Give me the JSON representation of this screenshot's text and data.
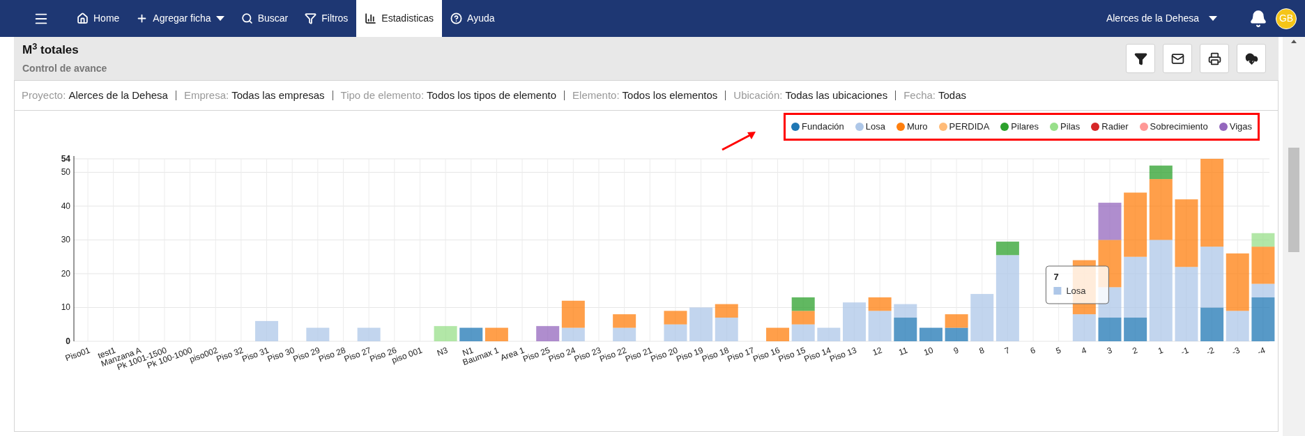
{
  "nav": {
    "items": [
      {
        "label": "Home",
        "has_menu": false,
        "selected": false
      },
      {
        "label": "Agregar ficha",
        "has_menu": true,
        "selected": false
      },
      {
        "label": "Buscar",
        "has_menu": false,
        "selected": false
      },
      {
        "label": "Filtros",
        "has_menu": false,
        "selected": false
      },
      {
        "label": "Estadisticas",
        "has_menu": false,
        "selected": true
      },
      {
        "label": "Ayuda",
        "has_menu": false,
        "selected": false
      }
    ],
    "project": "Alerces de la Dehesa",
    "avatar": "GB"
  },
  "header": {
    "title": "M$^{3}$ totales",
    "subtitle": "Control de avance"
  },
  "filters": [
    {
      "label": "Proyecto:",
      "value": "Alerces de la Dehesa"
    },
    {
      "label": "Empresa:",
      "value": "Todas las empresas"
    },
    {
      "label": "Tipo de elemento:",
      "value": "Todos los tipos de elemento"
    },
    {
      "label": "Elemento:",
      "value": "Todos los elementos"
    },
    {
      "label": "Ubicación:",
      "value": "Todas las ubicaciones"
    },
    {
      "label": "Fecha:",
      "value": "Todas"
    }
  ],
  "chart": {
    "tooltip": {
      "title": "7",
      "items": [
        {
          "name": "Losa",
          "color": "#aec7e8"
        }
      ]
    },
    "chart_data": {
      "type": "bar",
      "stacked": true,
      "orientation": "vertical",
      "grid": true,
      "ylim": [
        0,
        54
      ],
      "yticks": [
        0,
        10,
        20,
        30,
        40,
        50,
        54
      ],
      "categories": [
        "Piso01",
        "test1",
        "Manzana A",
        "Pk 1001-1500",
        "Pk 100-1000",
        "piso002",
        "Piso 32",
        "Piso 31",
        "Piso 30",
        "Piso 29",
        "Piso 28",
        "Piso 27",
        "Piso 26",
        "piso 001",
        "N3",
        "N1",
        "Baumax 1",
        "Area 1",
        "Piso 25",
        "Piso 24",
        "Piso 23",
        "Piso 22",
        "Piso 21",
        "Piso 20",
        "Piso 19",
        "Piso 18",
        "Piso 17",
        "Piso 16",
        "Piso 15",
        "Piso 14",
        "Piso 13",
        "12",
        "11",
        "10",
        "9",
        "8",
        "7",
        "6",
        "5",
        "4",
        "3",
        "2",
        "1",
        "-1",
        "-2",
        "-3",
        "-4"
      ],
      "series": [
        {
          "name": "Fundación",
          "color": "#1f77b4",
          "values": [
            null,
            null,
            null,
            null,
            null,
            null,
            null,
            null,
            null,
            null,
            null,
            null,
            null,
            null,
            null,
            4,
            null,
            null,
            null,
            null,
            null,
            null,
            null,
            null,
            null,
            null,
            null,
            null,
            null,
            null,
            null,
            null,
            7,
            4,
            4,
            null,
            null,
            null,
            null,
            null,
            7,
            7,
            null,
            null,
            10,
            null,
            13
          ]
        },
        {
          "name": "Losa",
          "color": "#aec7e8",
          "values": [
            null,
            null,
            null,
            null,
            null,
            null,
            null,
            6,
            null,
            4,
            null,
            4,
            null,
            null,
            null,
            null,
            null,
            null,
            null,
            4,
            null,
            4,
            null,
            5,
            10,
            7,
            null,
            null,
            5,
            4,
            11.5,
            9,
            4,
            null,
            null,
            14,
            25.5,
            null,
            null,
            8,
            9,
            18,
            30,
            22,
            18,
            9,
            4
          ]
        },
        {
          "name": "Muro",
          "color": "#ff7f0e",
          "values": [
            null,
            null,
            null,
            null,
            null,
            null,
            null,
            null,
            null,
            null,
            null,
            null,
            null,
            null,
            null,
            null,
            4,
            null,
            null,
            8,
            null,
            4,
            null,
            4,
            null,
            4,
            null,
            4,
            4,
            null,
            null,
            4,
            null,
            null,
            4,
            null,
            null,
            null,
            null,
            16,
            14,
            19,
            18,
            20,
            26,
            17,
            11
          ]
        },
        {
          "name": "PERDIDA",
          "color": "#ffbb78",
          "values": [
            null,
            null,
            null,
            null,
            null,
            null,
            null,
            null,
            null,
            null,
            null,
            null,
            null,
            null,
            null,
            null,
            null,
            null,
            null,
            null,
            null,
            null,
            null,
            null,
            null,
            null,
            null,
            null,
            null,
            null,
            null,
            null,
            null,
            null,
            null,
            null,
            null,
            null,
            null,
            null,
            null,
            null,
            null,
            null,
            null,
            null,
            null
          ]
        },
        {
          "name": "Pilares",
          "color": "#2ca02c",
          "values": [
            null,
            null,
            null,
            null,
            null,
            null,
            null,
            null,
            null,
            null,
            null,
            null,
            null,
            null,
            null,
            null,
            null,
            null,
            null,
            null,
            null,
            null,
            null,
            null,
            null,
            null,
            null,
            null,
            4,
            null,
            null,
            null,
            null,
            null,
            null,
            null,
            4,
            null,
            null,
            null,
            null,
            null,
            4,
            null,
            null,
            null,
            null
          ]
        },
        {
          "name": "Pilas",
          "color": "#98df8a",
          "values": [
            null,
            null,
            null,
            null,
            null,
            null,
            null,
            null,
            null,
            null,
            null,
            null,
            null,
            null,
            4.5,
            null,
            null,
            null,
            null,
            null,
            null,
            null,
            null,
            null,
            null,
            null,
            null,
            null,
            null,
            null,
            null,
            null,
            null,
            null,
            null,
            null,
            null,
            null,
            null,
            null,
            null,
            null,
            null,
            null,
            null,
            null,
            4
          ]
        },
        {
          "name": "Radier",
          "color": "#d62728",
          "values": [
            null,
            null,
            null,
            null,
            null,
            null,
            null,
            null,
            null,
            null,
            null,
            null,
            null,
            null,
            null,
            null,
            null,
            null,
            null,
            null,
            null,
            null,
            null,
            null,
            null,
            null,
            null,
            null,
            null,
            null,
            null,
            null,
            null,
            null,
            null,
            null,
            null,
            null,
            null,
            null,
            null,
            null,
            null,
            null,
            null,
            null,
            null
          ]
        },
        {
          "name": "Sobrecimiento",
          "color": "#ff9896",
          "values": [
            null,
            null,
            null,
            null,
            null,
            null,
            null,
            null,
            null,
            null,
            null,
            null,
            null,
            null,
            null,
            null,
            null,
            null,
            null,
            null,
            null,
            null,
            null,
            null,
            null,
            null,
            null,
            null,
            null,
            null,
            null,
            null,
            null,
            null,
            null,
            null,
            null,
            null,
            null,
            null,
            null,
            null,
            null,
            null,
            null,
            null,
            null
          ]
        },
        {
          "name": "Vigas",
          "color": "#9467bd",
          "values": [
            null,
            null,
            null,
            null,
            null,
            null,
            null,
            null,
            null,
            null,
            null,
            null,
            null,
            null,
            null,
            null,
            null,
            null,
            4.5,
            null,
            null,
            null,
            null,
            null,
            null,
            null,
            null,
            null,
            null,
            null,
            null,
            null,
            null,
            null,
            null,
            null,
            null,
            null,
            null,
            null,
            11,
            null,
            null,
            null,
            null,
            null,
            null
          ]
        }
      ]
    }
  }
}
